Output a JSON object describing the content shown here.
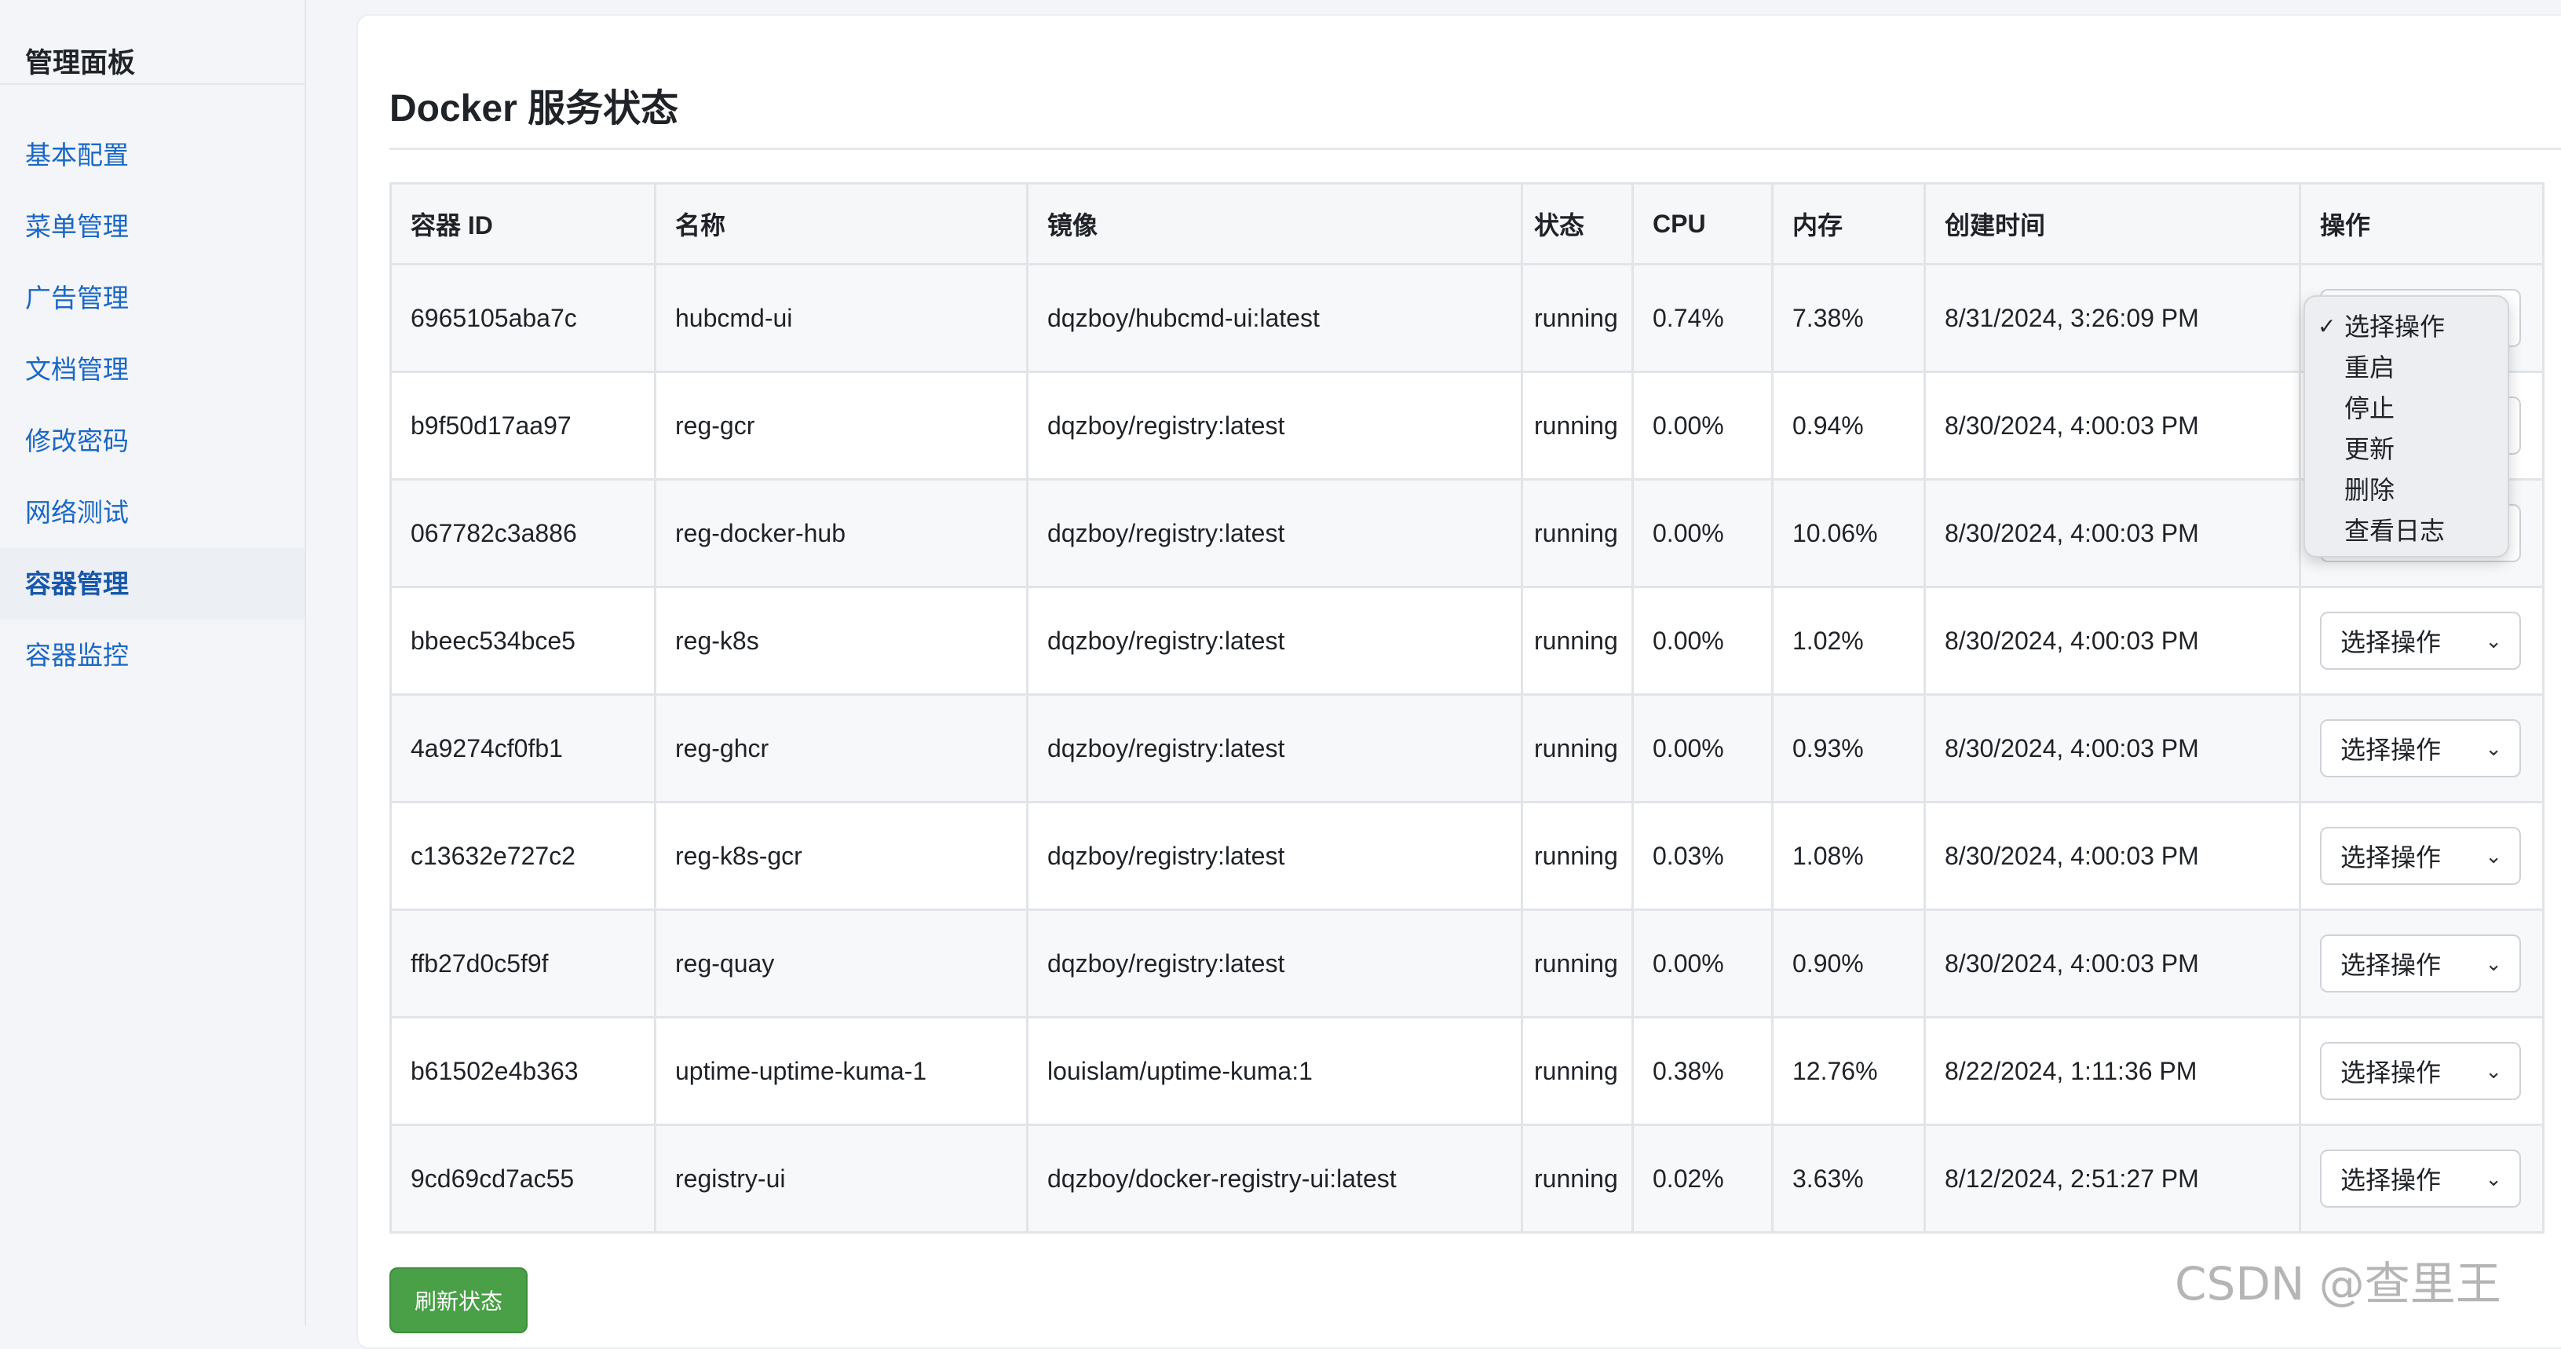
{
  "sidebar": {
    "title": "管理面板",
    "items": [
      {
        "label": "基本配置"
      },
      {
        "label": "菜单管理"
      },
      {
        "label": "广告管理"
      },
      {
        "label": "文档管理"
      },
      {
        "label": "修改密码"
      },
      {
        "label": "网络测试"
      },
      {
        "label": "容器管理"
      },
      {
        "label": "容器监控"
      }
    ],
    "active_index": 6
  },
  "main": {
    "title": "Docker 服务状态",
    "table": {
      "headers": [
        "容器 ID",
        "名称",
        "镜像",
        "状态",
        "CPU",
        "内存",
        "创建时间",
        "操作"
      ],
      "rows": [
        {
          "id": "6965105aba7c",
          "name": "hubcmd-ui",
          "image": "dqzboy/hubcmd-ui:latest",
          "status": "running",
          "cpu": "0.74%",
          "mem": "7.38%",
          "created": "8/31/2024, 3:26:09 PM",
          "action": "选择操作"
        },
        {
          "id": "b9f50d17aa97",
          "name": "reg-gcr",
          "image": "dqzboy/registry:latest",
          "status": "running",
          "cpu": "0.00%",
          "mem": "0.94%",
          "created": "8/30/2024, 4:00:03 PM",
          "action": "选择操作"
        },
        {
          "id": "067782c3a886",
          "name": "reg-docker-hub",
          "image": "dqzboy/registry:latest",
          "status": "running",
          "cpu": "0.00%",
          "mem": "10.06%",
          "created": "8/30/2024, 4:00:03 PM",
          "action": "选择操作"
        },
        {
          "id": "bbeec534bce5",
          "name": "reg-k8s",
          "image": "dqzboy/registry:latest",
          "status": "running",
          "cpu": "0.00%",
          "mem": "1.02%",
          "created": "8/30/2024, 4:00:03 PM",
          "action": "选择操作"
        },
        {
          "id": "4a9274cf0fb1",
          "name": "reg-ghcr",
          "image": "dqzboy/registry:latest",
          "status": "running",
          "cpu": "0.00%",
          "mem": "0.93%",
          "created": "8/30/2024, 4:00:03 PM",
          "action": "选择操作"
        },
        {
          "id": "c13632e727c2",
          "name": "reg-k8s-gcr",
          "image": "dqzboy/registry:latest",
          "status": "running",
          "cpu": "0.03%",
          "mem": "1.08%",
          "created": "8/30/2024, 4:00:03 PM",
          "action": "选择操作"
        },
        {
          "id": "ffb27d0c5f9f",
          "name": "reg-quay",
          "image": "dqzboy/registry:latest",
          "status": "running",
          "cpu": "0.00%",
          "mem": "0.90%",
          "created": "8/30/2024, 4:00:03 PM",
          "action": "选择操作"
        },
        {
          "id": "b61502e4b363",
          "name": "uptime-uptime-kuma-1",
          "image": "louislam/uptime-kuma:1",
          "status": "running",
          "cpu": "0.38%",
          "mem": "12.76%",
          "created": "8/22/2024, 1:11:36 PM",
          "action": "选择操作"
        },
        {
          "id": "9cd69cd7ac55",
          "name": "registry-ui",
          "image": "dqzboy/docker-registry-ui:latest",
          "status": "running",
          "cpu": "0.02%",
          "mem": "3.63%",
          "created": "8/12/2024, 2:51:27 PM",
          "action": "选择操作"
        }
      ]
    },
    "dropdown": {
      "check": "✓",
      "options": [
        "选择操作",
        "重启",
        "停止",
        "更新",
        "删除",
        "查看日志"
      ]
    },
    "refresh_label": "刷新状态"
  },
  "watermark": "CSDN @查里王",
  "colors": {
    "accent": "#1a67c6",
    "button_green": "#49a047"
  }
}
